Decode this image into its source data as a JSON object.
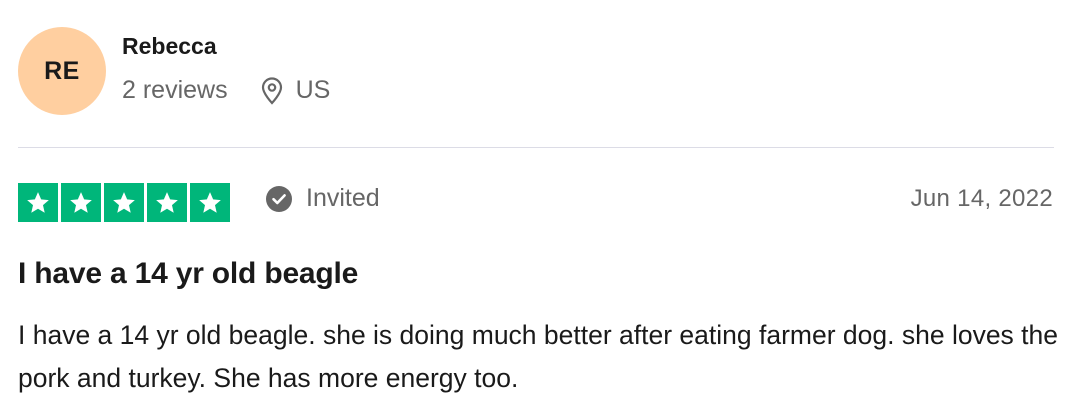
{
  "reviewer": {
    "initials": "RE",
    "avatar_color": "#ffcfa0",
    "name": "Rebecca",
    "review_count": "2 reviews",
    "location_icon": "location-pin-icon",
    "country": "US"
  },
  "review": {
    "rating": 5,
    "rating_max": 5,
    "star_color": "#00b67a",
    "status_icon": "check-circle-icon",
    "status_label": "Invited",
    "date": "Jun 14, 2022",
    "title": "I have a 14 yr old beagle",
    "body": "I have a 14 yr old beagle. she is doing much better after eating farmer dog. she loves the pork and turkey. She has more energy too."
  }
}
